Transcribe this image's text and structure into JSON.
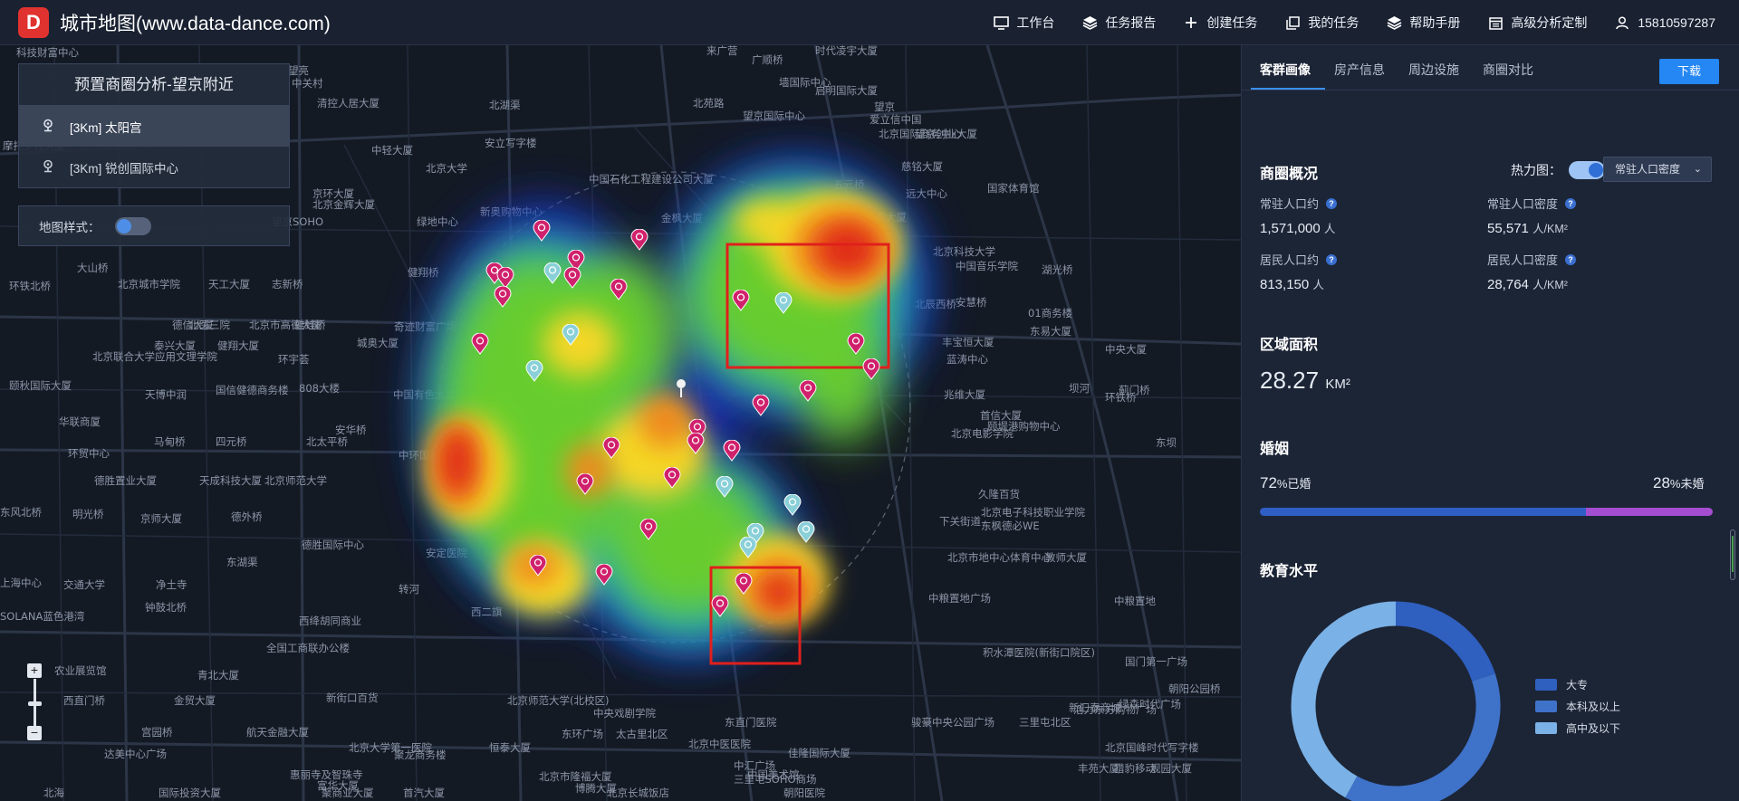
{
  "app": {
    "logo_letter": "D",
    "title": "城市地图(www.data-dance.com)"
  },
  "nav": [
    {
      "label": "工作台",
      "icon": "monitor-icon"
    },
    {
      "label": "任务报告",
      "icon": "layers-icon"
    },
    {
      "label": "创建任务",
      "icon": "plus-icon"
    },
    {
      "label": "我的任务",
      "icon": "copy-icon"
    },
    {
      "label": "帮助手册",
      "icon": "stack-icon"
    },
    {
      "label": "高级分析定制",
      "icon": "calendar-icon"
    },
    {
      "label": "15810597287",
      "icon": "user-icon"
    }
  ],
  "preset": {
    "title": "预置商圈分析-望京附近",
    "items": [
      {
        "label": "[3Km] 太阳宫"
      },
      {
        "label": "[3Km] 锐创国际中心"
      }
    ]
  },
  "map_style": {
    "label": "地图样式："
  },
  "zoom": {
    "plus": "+",
    "minus": "−"
  },
  "sidebar": {
    "tabs": [
      "客群画像",
      "房产信息",
      "周边设施",
      "商圈对比"
    ],
    "download_label": "下载",
    "overview": {
      "title": "商圈概况",
      "heatmap_label": "热力图：",
      "heatmap_select": "常驻人口密度",
      "stats": [
        {
          "label": "常驻人口约",
          "value": "1,571,000",
          "unit": "人"
        },
        {
          "label": "常驻人口密度",
          "value": "55,571",
          "unit": "人/KM²"
        },
        {
          "label": "居民人口约",
          "value": "813,150",
          "unit": "人"
        },
        {
          "label": "居民人口密度",
          "value": "28,764",
          "unit": "人/KM²"
        }
      ]
    },
    "area": {
      "title": "区域面积",
      "value": "28.27",
      "unit": "KM²"
    },
    "marriage": {
      "title": "婚姻",
      "married_pct": "72",
      "married_label": "%已婚",
      "unmarried_pct": "28",
      "unmarried_label": "%未婚",
      "married_color": "#2f5fc4",
      "unmarried_color": "#a44ecf"
    },
    "education": {
      "title": "教育水平",
      "legend": [
        {
          "label": "大专",
          "color": "#2f5fbf"
        },
        {
          "label": "本科及以上",
          "color": "#3f72c9"
        },
        {
          "label": "高中及以下",
          "color": "#7ab1e6"
        }
      ]
    }
  },
  "chart_data": {
    "type": "pie",
    "title": "教育水平",
    "categories": [
      "大专",
      "本科及以上",
      "高中及以下"
    ],
    "values": [
      20,
      38,
      42
    ],
    "colors": [
      "#2f5fbf",
      "#3f72c9",
      "#7ab1e6"
    ]
  },
  "map_labels": [
    "科技财富中心",
    "来广营",
    "广顺桥",
    "时代凌宇大厦",
    "望亮",
    "中关村",
    "墙国际中心",
    "启明国际大厦",
    "清控人居大厦",
    "北苑路",
    "北湖渠",
    "望京国际中心",
    "望京",
    "爱立信中国",
    "北京国际商务中心",
    "望京创业大厦",
    "摩托罗拉大厦",
    "中轻大厦",
    "北京大学",
    "安立写字楼",
    "中国石化工程建设公司大厦",
    "慈铭大厦",
    "京环大厦",
    "北京金辉大厦",
    "新奥购物中心",
    "五元桥",
    "国家体育馆",
    "远大中心",
    "绿地中心",
    "北京大厦",
    "望京SOHO",
    "金枫大厦",
    "北京科技大学",
    "中国音乐学院",
    "湖光桥",
    "大山桥",
    "环铁北桥",
    "北京城市学院",
    "天工大厦",
    "志新桥",
    "健翔桥",
    "北辰西桥",
    "安慧桥",
    "01商务楼",
    "东易大厦",
    "德信大厦",
    "北医三院",
    "北京市高德大厦",
    "蛙蛙桥",
    "奇迹财富广场",
    "北京联合大学应用文理学院",
    "泰兴大厦",
    "健翔大厦",
    "城奥大厦",
    "环宇荟",
    "丰宝恒大厦",
    "蓝涛中心",
    "中央大厦",
    "坝河",
    "环铁桥",
    "颐秋国际大厦",
    "天博中润",
    "808大楼",
    "国信健德商务楼",
    "中国有色大厦",
    "兆维大厦",
    "首信大厦",
    "颐堤港购物中心",
    "北京电影学院",
    "华联商厦",
    "安华桥",
    "北太平桥",
    "马甸桥",
    "四元桥",
    "恒大城市广场",
    "东坝",
    "蓟门桥",
    "环贸中心",
    "中环国投大厦",
    "北京师范大学",
    "德胜置业大厦",
    "天成科技大厦",
    "久隆百货",
    "北京电子科技职业学院",
    "东风北桥",
    "下关街道",
    "明光桥",
    "京师大厦",
    "德外桥",
    "东枫德必WE",
    "德胜国际中心",
    "安定医院",
    "教师大厦",
    "北京市地中心体育中心",
    "东湖渠",
    "上海中心",
    "交通大学",
    "净土寺",
    "转河",
    "西二旗",
    "中粮置地广场",
    "中粮置地",
    "钟鼓北桥",
    "西绛胡同商业",
    "SOLANA蓝色港湾",
    "青北大厦",
    "全国工商联办公楼",
    "积水潭医院(新街口院区)",
    "国门第一广场",
    "农业展览馆",
    "西直门桥",
    "金贸大厦",
    "新街口百货",
    "北京师范大学(北校区)",
    "中央戏剧学院",
    "东直门医院",
    "东环广场",
    "太古里北区",
    "三里屯北区",
    "活力东方购物广场",
    "绿森时代广场",
    "朝阳公园桥",
    "新汇泰商城",
    "达美中心广场",
    "宫园桥",
    "航天金融大厦",
    "北京大学第一医院",
    "北京中医医院",
    "中汇广场",
    "三里屯SOHO商场",
    "佳隆国际大厦",
    "骏豪中央公园广场",
    "丰苑大厦",
    "北京国峰时代写字楼",
    "猎豹移动",
    "观园大厦",
    "国际投资大厦",
    "北海",
    "惠丽寺及智珠寺",
    "富华大厦",
    "聚商业大厦",
    "聚龙商务楼",
    "恒泰大厦",
    "北京市隆福大厦",
    "博腾大厦",
    "中国美术馆",
    "朝阳医院",
    "首汽大厦",
    "北京长城饭店"
  ]
}
